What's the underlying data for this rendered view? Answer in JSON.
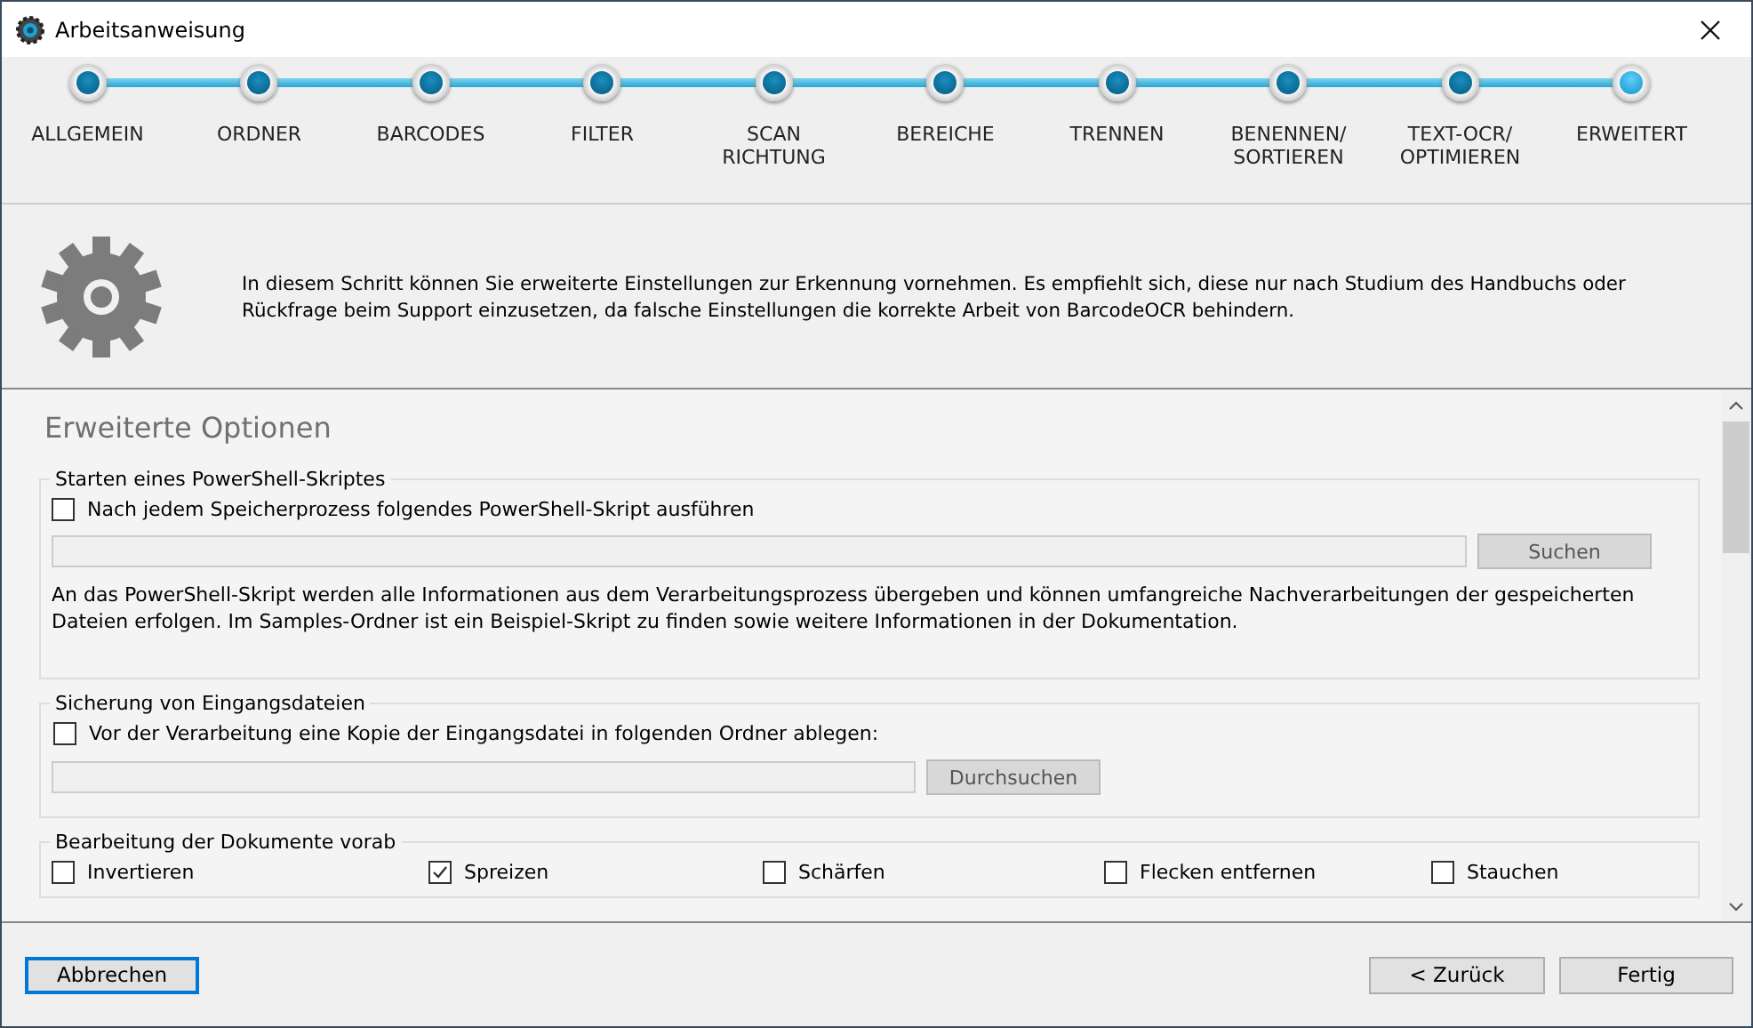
{
  "window": {
    "title": "Arbeitsanweisung"
  },
  "steps": [
    {
      "label": "ALLGEMEIN",
      "selected": false
    },
    {
      "label": "ORDNER",
      "selected": false
    },
    {
      "label": "BARCODES",
      "selected": false
    },
    {
      "label": "FILTER",
      "selected": false
    },
    {
      "label": "SCAN RICHTUNG",
      "selected": false
    },
    {
      "label": "BEREICHE",
      "selected": false
    },
    {
      "label": "TRENNEN",
      "selected": false
    },
    {
      "label": "BENENNEN/ SORTIEREN",
      "selected": false
    },
    {
      "label": "TEXT-OCR/ OPTIMIEREN",
      "selected": false
    },
    {
      "label": "ERWEITERT",
      "selected": true
    }
  ],
  "info": {
    "text": "In diesem Schritt können Sie erweiterte Einstellungen zur Erkennung vornehmen. Es empfiehlt sich, diese nur nach Studium des Handbuchs oder Rückfrage beim Support einzusetzen, da falsche Einstellungen die korrekte Arbeit von BarcodeOCR behindern."
  },
  "options": {
    "heading": "Erweiterte Optionen",
    "groups": [
      {
        "kind": "path",
        "title": "Starten eines PowerShell-Skriptes",
        "checkbox": {
          "label": "Nach jedem Speicherprozess folgendes PowerShell-Skript ausführen",
          "checked": false
        },
        "button": "Suchen",
        "note": "An das PowerShell-Skript werden alle Informationen aus dem Verarbeitungsprozess übergeben und können umfangreiche Nachverarbeitungen der gespeicherten Dateien erfolgen. Im Samples-Ordner ist ein Beispiel-Skript zu finden sowie weitere Informationen in der Dokumentation."
      },
      {
        "kind": "path",
        "title": "Sicherung von Eingangsdateien",
        "checkbox": {
          "label": "Vor der Verarbeitung eine Kopie der Eingangsdatei in folgenden Ordner ablegen:",
          "checked": false
        },
        "button": "Durchsuchen"
      },
      {
        "kind": "checks",
        "title": "Bearbeitung der Dokumente vorab",
        "checkboxes": [
          {
            "label": "Invertieren",
            "checked": false
          },
          {
            "label": "Spreizen",
            "checked": true
          },
          {
            "label": "Schärfen",
            "checked": false
          },
          {
            "label": "Flecken entfernen",
            "checked": false
          },
          {
            "label": "Stauchen",
            "checked": false
          }
        ]
      }
    ]
  },
  "footer": {
    "cancel": "Abbrechen",
    "back": "< Zurück",
    "finish": "Fertig"
  }
}
